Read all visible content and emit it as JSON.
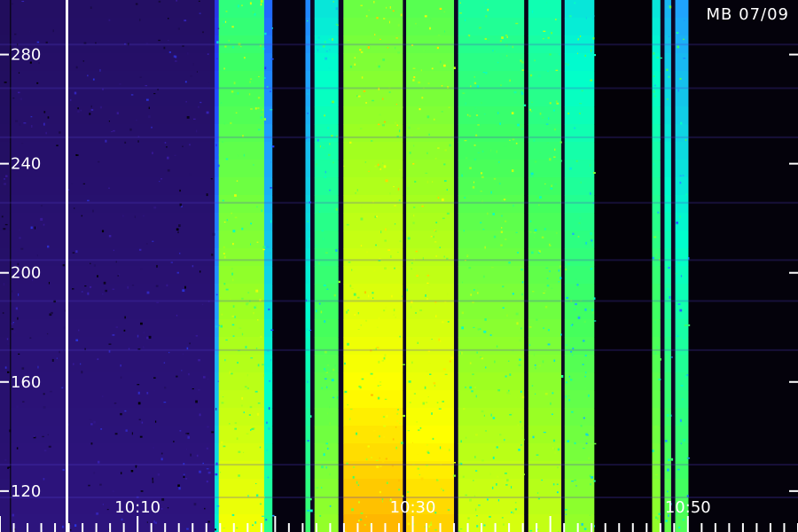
{
  "station_label": "MB 07/09",
  "chart_data": {
    "type": "heatmap",
    "title": "",
    "xlabel": "",
    "ylabel": "",
    "x_axis": {
      "unit": "time",
      "range_minutes": [
        10.0,
        10.9667
      ],
      "tick_labels": [
        {
          "label": "10:10",
          "value": 10.1667
        },
        {
          "label": "10:30",
          "value": 10.5
        },
        {
          "label": "10:50",
          "value": 10.8333
        }
      ]
    },
    "y_axis": {
      "range": [
        105,
        300
      ],
      "ticks": [
        120,
        160,
        200,
        240,
        280
      ]
    },
    "colormap": [
      "#000000",
      "#1a0a4a",
      "#3a1aa0",
      "#2040ff",
      "#20a0ff",
      "#00ffcc",
      "#40ff60",
      "#a0ff20",
      "#ffff00",
      "#ff8000",
      "#ff2000"
    ],
    "intensity_bands": [
      {
        "t_start": 10.0,
        "t_end": 10.0122,
        "level": 0.12
      },
      {
        "t_start": 10.0122,
        "t_end": 10.0133,
        "level": 0.0
      },
      {
        "t_start": 10.0133,
        "t_end": 10.26,
        "level": 0.13
      },
      {
        "t_start": 10.26,
        "t_end": 10.265,
        "level": 0.35
      },
      {
        "t_start": 10.265,
        "t_end": 10.32,
        "level": 0.65
      },
      {
        "t_start": 10.32,
        "t_end": 10.33,
        "level": 0.42
      },
      {
        "t_start": 10.33,
        "t_end": 10.37,
        "level": 0.02
      },
      {
        "t_start": 10.37,
        "t_end": 10.376,
        "level": 0.45
      },
      {
        "t_start": 10.376,
        "t_end": 10.381,
        "level": 0.05
      },
      {
        "t_start": 10.381,
        "t_end": 10.41,
        "level": 0.55
      },
      {
        "t_start": 10.41,
        "t_end": 10.416,
        "level": 0.05
      },
      {
        "t_start": 10.416,
        "t_end": 10.488,
        "level": 0.72
      },
      {
        "t_start": 10.488,
        "t_end": 10.492,
        "level": 0.05
      },
      {
        "t_start": 10.492,
        "t_end": 10.55,
        "level": 0.7
      },
      {
        "t_start": 10.55,
        "t_end": 10.555,
        "level": 0.05
      },
      {
        "t_start": 10.555,
        "t_end": 10.635,
        "level": 0.62
      },
      {
        "t_start": 10.635,
        "t_end": 10.64,
        "level": 0.03
      },
      {
        "t_start": 10.64,
        "t_end": 10.68,
        "level": 0.6
      },
      {
        "t_start": 10.68,
        "t_end": 10.684,
        "level": 0.05
      },
      {
        "t_start": 10.684,
        "t_end": 10.72,
        "level": 0.55
      },
      {
        "t_start": 10.72,
        "t_end": 10.79,
        "level": 0.01
      },
      {
        "t_start": 10.79,
        "t_end": 10.8,
        "level": 0.55
      },
      {
        "t_start": 10.8,
        "t_end": 10.805,
        "level": 0.05
      },
      {
        "t_start": 10.805,
        "t_end": 10.813,
        "level": 0.5
      },
      {
        "t_start": 10.813,
        "t_end": 10.818,
        "level": 0.05
      },
      {
        "t_start": 10.818,
        "t_end": 10.834,
        "level": 0.48
      },
      {
        "t_start": 10.834,
        "t_end": 10.9667,
        "level": 0.015
      }
    ],
    "legend": "none",
    "grid": false
  }
}
